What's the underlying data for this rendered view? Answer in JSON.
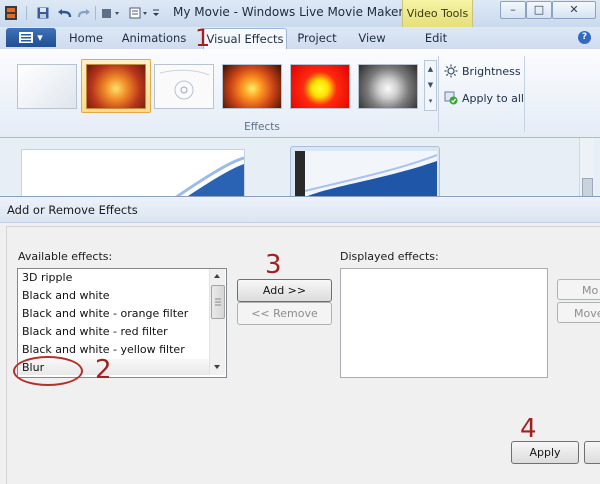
{
  "window": {
    "title": "My Movie - Windows Live Movie Maker",
    "contextual_tab_group": "Video Tools",
    "controls": {
      "minimize": "–",
      "maximize": "□",
      "close": "✕"
    }
  },
  "quick_access": {
    "icons": [
      "app-icon",
      "save-icon",
      "undo-icon",
      "redo-icon",
      "dropdown-icon"
    ]
  },
  "ribbon": {
    "file_menu_label": "▾",
    "tabs": [
      {
        "label": "Home",
        "active": false
      },
      {
        "label": "Animations",
        "active": false
      },
      {
        "label": "Visual Effects",
        "active": true
      },
      {
        "label": "Project",
        "active": false
      },
      {
        "label": "View",
        "active": false
      },
      {
        "label": "Edit",
        "active": false
      }
    ],
    "help_label": "?",
    "effects_group_label": "Effects",
    "brightness_label": "Brightness",
    "apply_to_all_label": "Apply to all",
    "gallery_scroll": {
      "up": "▲",
      "down": "▼",
      "more": "▾"
    }
  },
  "dialog": {
    "title": "Add or Remove Effects",
    "available_label": "Available effects:",
    "displayed_label": "Displayed effects:",
    "available_items": [
      "3D ripple",
      "Black and white",
      "Black and white - orange filter",
      "Black and white - red filter",
      "Black and white - yellow filter",
      "Blur"
    ],
    "add_button": "Add >>",
    "remove_button": "<< Remove",
    "move_up_button": "Mo",
    "move_down_button": "Move",
    "apply_button": "Apply"
  },
  "annotations": {
    "step1": "1",
    "step2": "2",
    "step3": "3",
    "step4": "4"
  },
  "colors": {
    "accent_blue": "#2b5797",
    "contextual_yellow": "#e4e07a",
    "annotation_red": "#a0221f"
  }
}
